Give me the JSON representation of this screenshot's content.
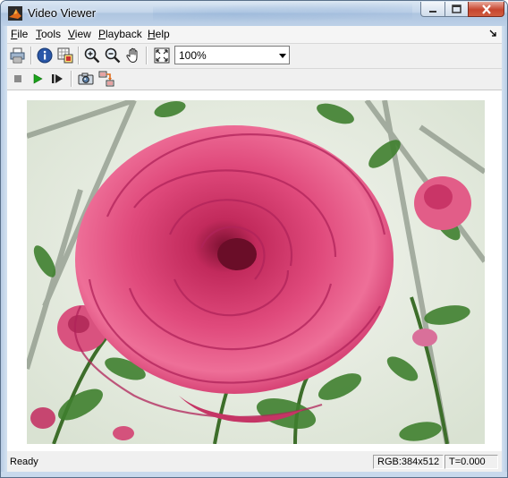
{
  "window": {
    "title": "Video Viewer",
    "app_icon": "matlab-logo-icon"
  },
  "menu": {
    "items": [
      {
        "label": "File"
      },
      {
        "label": "Tools"
      },
      {
        "label": "View"
      },
      {
        "label": "Playback"
      },
      {
        "label": "Help"
      }
    ],
    "dock_icon": "dock-arrow-icon"
  },
  "toolbar": {
    "icons": [
      "print-icon",
      "info-icon",
      "pixel-region-icon",
      "zoom-in-icon",
      "zoom-out-icon",
      "pan-hand-icon",
      "fit-to-window-icon"
    ],
    "zoom": {
      "value": "100%"
    }
  },
  "playback": {
    "icons": [
      "stop-icon",
      "play-icon",
      "step-forward-icon",
      "snapshot-icon",
      "export-icon"
    ]
  },
  "video": {
    "content": "pink rose photograph"
  },
  "status": {
    "text": "Ready",
    "rgb": "RGB:384x512",
    "time": "T=0.000"
  }
}
